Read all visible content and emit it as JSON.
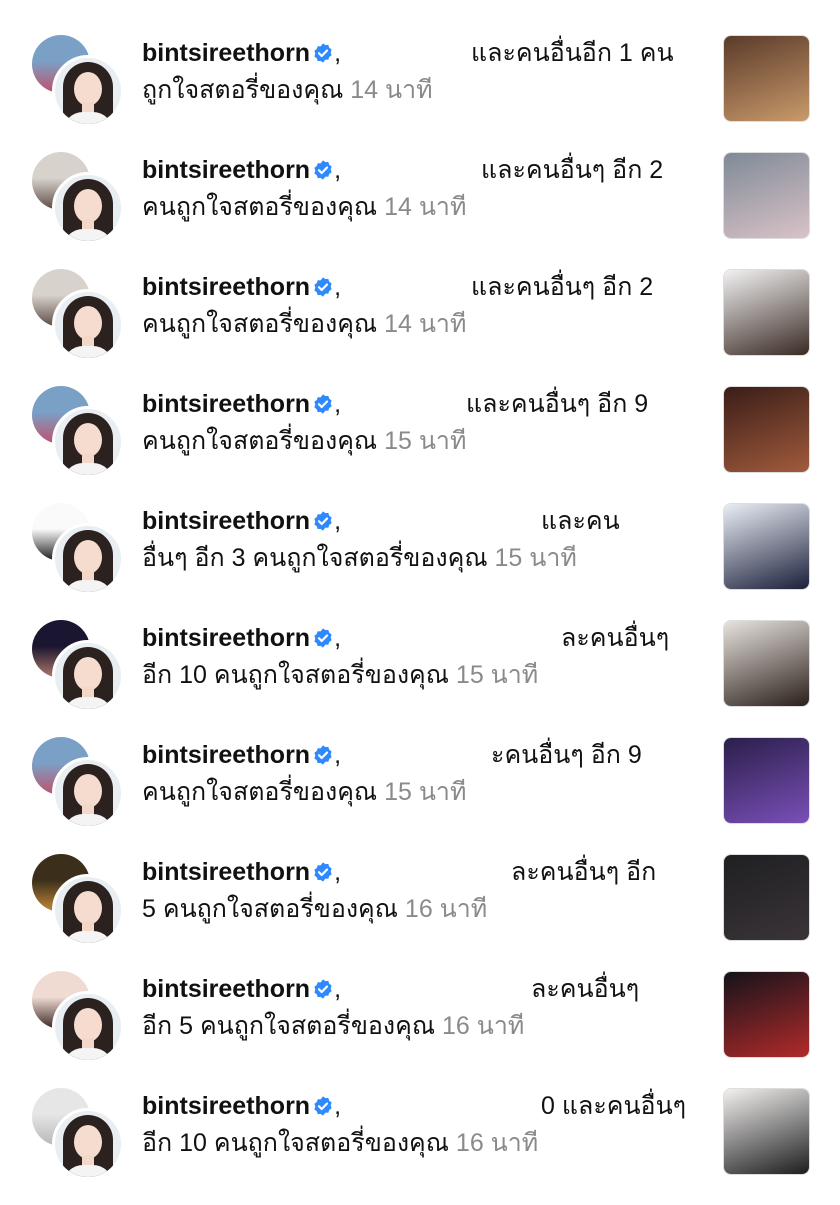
{
  "notifications": [
    {
      "user": "bintsireethorn",
      "l1_rest": "และคนอื่นอีก 1 คน",
      "l2": "ถูกใจสตอรี่ของคุณ",
      "time": "14 นาที",
      "thumb_colors": [
        "#5a3a2a",
        "#c99a6b"
      ],
      "back_colors": [
        "#7aa0c6",
        "#c0506a"
      ]
    },
    {
      "user": "bintsireethorn",
      "l1_rest": "และคนอื่นๆ อีก 2",
      "l2": "คนถูกใจสตอรี่ของคุณ",
      "time": "14 นาที",
      "thumb_colors": [
        "#7f8a96",
        "#d9c2c8"
      ],
      "back_colors": [
        "#d8d2cc",
        "#5a4b43"
      ]
    },
    {
      "user": "bintsireethorn",
      "l1_rest": "และคนอื่นๆ อีก 2",
      "l2": "คนถูกใจสตอรี่ของคุณ",
      "time": "14 นาที",
      "thumb_colors": [
        "#f2f2f2",
        "#3a2a24"
      ],
      "back_colors": [
        "#d8d2cc",
        "#5a4b43"
      ]
    },
    {
      "user": "bintsireethorn",
      "l1_rest": "และคนอื่นๆ อีก 9",
      "l2": "คนถูกใจสตอรี่ของคุณ",
      "time": "15 นาที",
      "thumb_colors": [
        "#3a1d18",
        "#a15b3c"
      ],
      "back_colors": [
        "#7aa0c6",
        "#c0506a"
      ]
    },
    {
      "user": "bintsireethorn",
      "l1_rest": "และคน",
      "l2": "อื่นๆ อีก 3 คนถูกใจสตอรี่ของคุณ",
      "time": "15 นาที",
      "thumb_colors": [
        "#e9eef5",
        "#1b1f3a"
      ],
      "back_colors": [
        "#fafafa",
        "#1a1a1a"
      ]
    },
    {
      "user": "bintsireethorn",
      "l1_rest": "ละคนอื่นๆ",
      "l2": "อีก 10 คนถูกใจสตอรี่ของคุณ",
      "time": "15 นาที",
      "thumb_colors": [
        "#e8e3de",
        "#2b201b"
      ],
      "back_colors": [
        "#1a1530",
        "#b07a6a"
      ]
    },
    {
      "user": "bintsireethorn",
      "l1_rest": "ะคนอื่นๆ อีก 9",
      "l2": "คนถูกใจสตอรี่ของคุณ",
      "time": "15 นาที",
      "thumb_colors": [
        "#2a1f4a",
        "#7a4fb8"
      ],
      "back_colors": [
        "#7aa0c6",
        "#c0506a"
      ]
    },
    {
      "user": "bintsireethorn",
      "l1_rest": "ละคนอื่นๆ อีก",
      "l2": "5 คนถูกใจสตอรี่ของคุณ",
      "time": "16 นาที",
      "thumb_colors": [
        "#1f1f22",
        "#3a3438"
      ],
      "back_colors": [
        "#3b2f1c",
        "#c48a3a"
      ]
    },
    {
      "user": "bintsireethorn",
      "l1_rest": "ละคนอื่นๆ",
      "l2": "อีก 5 คนถูกใจสตอรี่ของคุณ",
      "time": "16 นาที",
      "thumb_colors": [
        "#14131a",
        "#b22a2a"
      ],
      "back_colors": [
        "#f0dbd3",
        "#3a2420"
      ]
    },
    {
      "user": "bintsireethorn",
      "l1_rest": "0 และคนอื่นๆ",
      "l2": "อีก 10 คนถูกใจสตอรี่ของคุณ",
      "time": "16 นาที",
      "thumb_colors": [
        "#f3f1ef",
        "#1d1d1f"
      ],
      "back_colors": [
        "#e6e6e6",
        "#b7b7b7"
      ]
    }
  ],
  "colors": {
    "verified": "#2e89ff",
    "time": "#8a8a8a",
    "text": "#111111"
  }
}
